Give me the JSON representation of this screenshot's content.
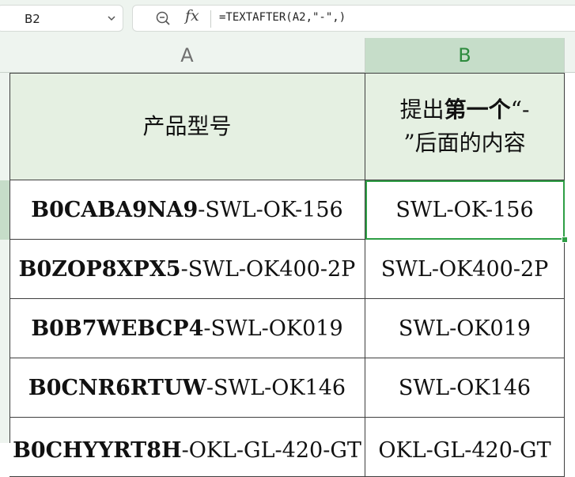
{
  "toolbar": {
    "name_box": "B2",
    "fx_label": "fx",
    "formula": "=TEXTAFTER(A2,\"-\",)"
  },
  "columns": {
    "a": "A",
    "b": "B"
  },
  "table": {
    "header_a": "产品型号",
    "header_b_line1_a": "提出",
    "header_b_line1_bold": "第一个",
    "header_b_line1_b": "“-",
    "header_b_line2": "”后面的内容",
    "rows": [
      {
        "a_bold": "B0CABA9NA9",
        "a_rest": "-SWL-OK-156",
        "b": "SWL-OK-156"
      },
      {
        "a_bold": "B0ZOP8XPX5",
        "a_rest": "-SWL-OK400-2P",
        "b": "SWL-OK400-2P"
      },
      {
        "a_bold": "B0B7WEBCP4",
        "a_rest": "-SWL-OK019",
        "b": "SWL-OK019"
      },
      {
        "a_bold": "B0CNR6RTUW",
        "a_rest": "-SWL-OK146",
        "b": "SWL-OK146"
      },
      {
        "a_bold": "B0CHYYRT8H",
        "a_rest": "-OKL-GL-420-GT",
        "b": "OKL-GL-420-GT"
      }
    ]
  },
  "colors": {
    "selection": "#2e9e45",
    "header_bg": "#e5f0e2",
    "selected_column_header": "#c6ddc9"
  },
  "icons": {
    "dropdown": "chevron-down-icon",
    "zoom": "zoom-out-icon"
  }
}
